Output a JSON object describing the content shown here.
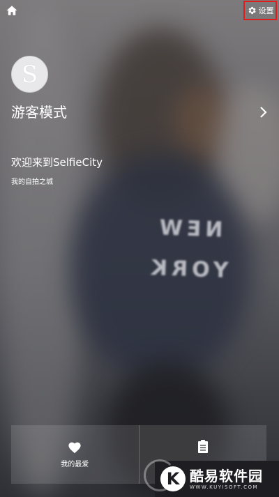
{
  "header": {
    "settings_label": "设置"
  },
  "profile": {
    "avatar_letter": "S",
    "guest_mode": "游客模式",
    "welcome": "欢迎来到SelfieCity",
    "tagline": "我的自拍之城"
  },
  "bottom_tabs": [
    {
      "label": "我的最爱",
      "icon": "heart-icon"
    },
    {
      "label": "",
      "icon": "list-icon"
    }
  ],
  "watermark": {
    "logo_letter": "K",
    "name": "酷易软件园",
    "url": "WWW.KUYISOFT.COM"
  },
  "colors": {
    "highlight_border": "#e31b1b"
  }
}
